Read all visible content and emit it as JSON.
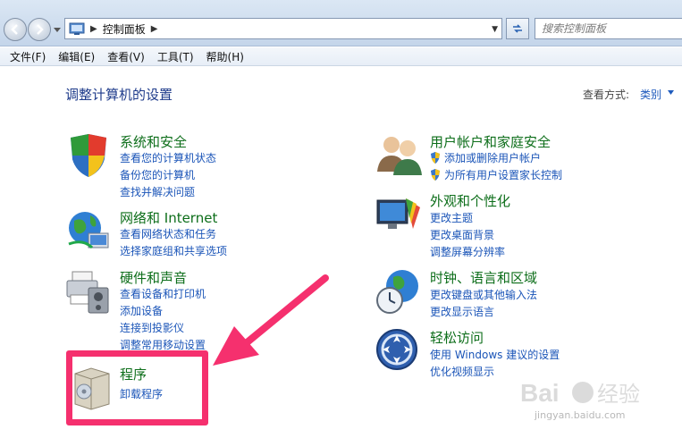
{
  "address": {
    "crumb": "控制面板",
    "search_placeholder": "搜索控制面板"
  },
  "menu": [
    "文件(F)",
    "编辑(E)",
    "查看(V)",
    "工具(T)",
    "帮助(H)"
  ],
  "main": {
    "title": "调整计算机的设置",
    "view_by_label": "查看方式:",
    "view_by_value": "类别"
  },
  "categories": {
    "system_security": {
      "title": "系统和安全",
      "links": [
        "查看您的计算机状态",
        "备份您的计算机",
        "查找并解决问题"
      ]
    },
    "network": {
      "title": "网络和 Internet",
      "links": [
        "查看网络状态和任务",
        "选择家庭组和共享选项"
      ]
    },
    "hardware": {
      "title": "硬件和声音",
      "links": [
        "查看设备和打印机",
        "添加设备",
        "连接到投影仪",
        "调整常用移动设置"
      ]
    },
    "programs": {
      "title": "程序",
      "links": [
        "卸载程序"
      ]
    },
    "user_accounts": {
      "title": "用户帐户和家庭安全",
      "links": [
        "添加或删除用户帐户",
        "为所有用户设置家长控制"
      ]
    },
    "appearance": {
      "title": "外观和个性化",
      "links": [
        "更改主题",
        "更改桌面背景",
        "调整屏幕分辨率"
      ]
    },
    "clock": {
      "title": "时钟、语言和区域",
      "links": [
        "更改键盘或其他输入法",
        "更改显示语言"
      ]
    },
    "ease": {
      "title": "轻松访问",
      "links": [
        "使用 Windows 建议的设置",
        "优化视频显示"
      ]
    }
  },
  "watermark": {
    "text": "jingyan.baidu.com"
  },
  "colors": {
    "category_title": "#0d6e1a",
    "link": "#1b55b8",
    "annotation": "#f5306e"
  }
}
